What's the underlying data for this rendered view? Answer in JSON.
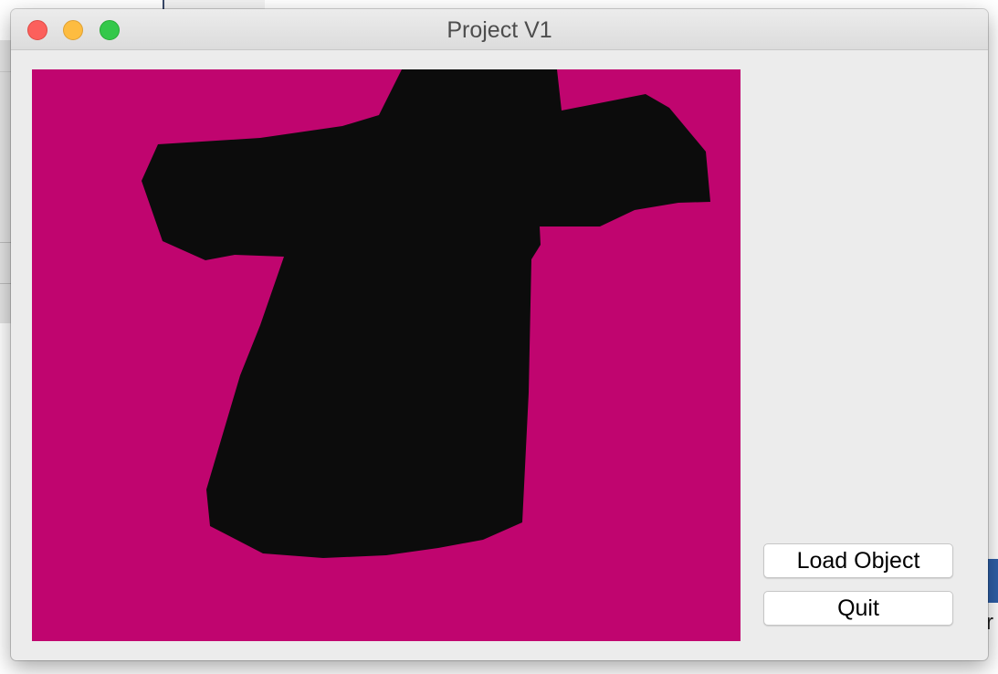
{
  "window": {
    "title": "Project V1"
  },
  "viewport": {
    "background_color": "#c0056f",
    "object_color": "#0c0c0c",
    "description_hidden": true
  },
  "controls": {
    "load_label": "Load Object",
    "quit_label": "Quit"
  },
  "icons": {
    "close": "close-icon",
    "minimize": "minimize-icon",
    "zoom": "zoom-icon"
  },
  "background": {
    "partial_glyph": "r"
  }
}
